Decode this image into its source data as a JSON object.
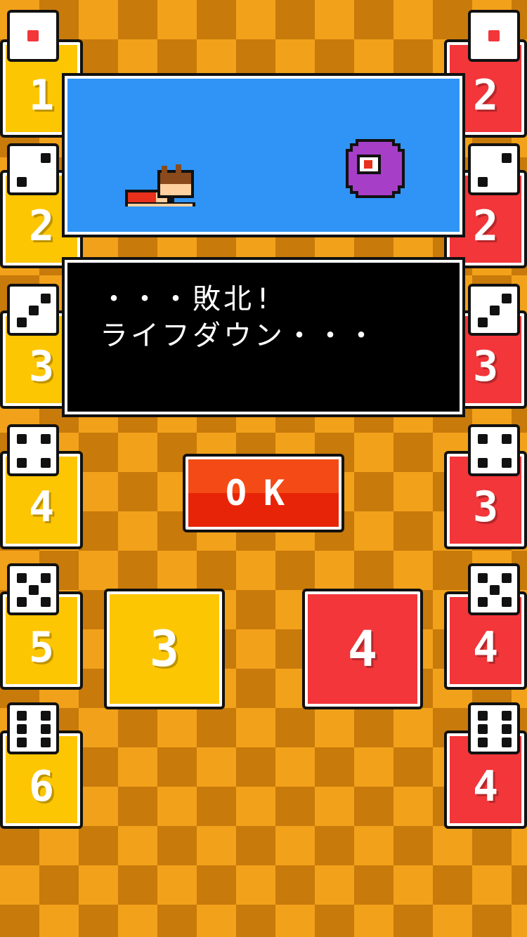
{
  "player_cards": [
    {
      "die": 1,
      "value": "1"
    },
    {
      "die": 2,
      "value": "2"
    },
    {
      "die": 3,
      "value": "3"
    },
    {
      "die": 4,
      "value": "4"
    },
    {
      "die": 5,
      "value": "5"
    },
    {
      "die": 6,
      "value": "6"
    }
  ],
  "enemy_cards": [
    {
      "die": 1,
      "value": "2"
    },
    {
      "die": 2,
      "value": "2"
    },
    {
      "die": 3,
      "value": "3"
    },
    {
      "die": 4,
      "value": "3"
    },
    {
      "die": 5,
      "value": "4"
    },
    {
      "die": 6,
      "value": "4"
    }
  ],
  "message": {
    "line1": "・・・敗北!",
    "line2": "ライフダウン・・・"
  },
  "ok_button": {
    "label": "OK"
  },
  "battle": {
    "player_card_value": "3",
    "enemy_card_value": "4"
  },
  "colors": {
    "player": "#fdc602",
    "enemy": "#f2363a",
    "sky": "#2f94f6",
    "button": "#e82408"
  }
}
